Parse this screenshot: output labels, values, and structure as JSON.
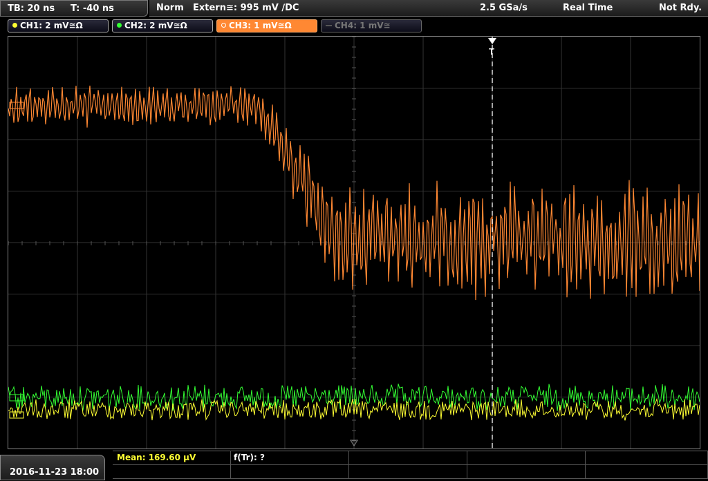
{
  "topbar": {
    "timebase": "TB: 20 ns",
    "trigger_time": "T: -40 ns",
    "mode": "Norm",
    "trigger_source": "Extern≅: 995 mV ∕DC",
    "sample_rate": "2.5 GSa/s",
    "acq_mode": "Real Time",
    "status": "Not Rdy."
  },
  "channels": [
    {
      "label": "CH1: 2 mV≅Ω",
      "color": "#ffff33",
      "active": true
    },
    {
      "label": "CH2: 2 mV≅Ω",
      "color": "#33ff33",
      "active": true
    },
    {
      "label": "CH3: 1 mV≅Ω",
      "color": "#ff8833",
      "active": true
    },
    {
      "label": "CH4: 1 mV≅",
      "color": "#777777",
      "active": false
    }
  ],
  "measurements": {
    "mean": "Mean: 169.60 µV",
    "rise": "f(Tr): ?"
  },
  "datetime": "2016-11-23 18:00",
  "colors": {
    "ch1": "#ffff33",
    "ch2": "#33ff33",
    "ch3": "#ff8833",
    "grid": "#3a3a3a",
    "trigger": "#ffffff"
  }
}
